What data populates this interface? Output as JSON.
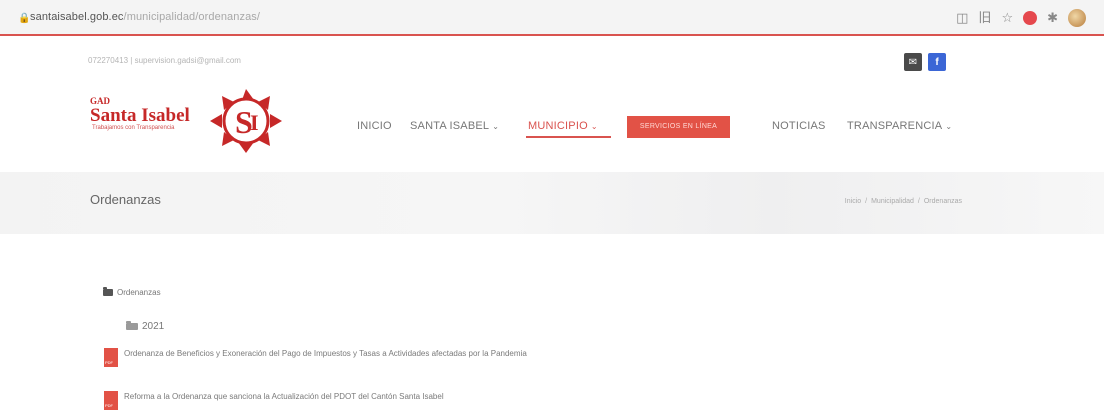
{
  "browser": {
    "url_host": "santaisabel.gob.ec",
    "url_path": "/municipalidad/ordenanzas/"
  },
  "topbar": {
    "contact": "072270413 | supervision.gadsi@gmail.com"
  },
  "logo": {
    "gad": "GAD",
    "name": "Santa Isabel",
    "tagline": "Trabajamos con Transparencia"
  },
  "nav": {
    "inicio": "INICIO",
    "santa_isabel": "SANTA ISABEL",
    "municipio": "MUNICIPIO",
    "servicios": "SERVICIOS EN LÍNEA",
    "noticias": "NOTICIAS",
    "transparencia": "TRANSPARENCIA",
    "caret": "⌄"
  },
  "page": {
    "title": "Ordenanzas",
    "breadcrumb": [
      "Inicio",
      "Municipalidad",
      "Ordenanzas"
    ],
    "crumb_sep": "/"
  },
  "tree": {
    "root_folder": "Ordenanzas",
    "year_folder": "2021",
    "documents": [
      "Ordenanza de Beneficios y Exoneración del Pago de Impuestos y Tasas a Actividades afectadas por la Pandemia",
      "Reforma a la Ordenanza que sanciona la Actualización del PDOT del Cantón Santa Isabel"
    ]
  },
  "colors": {
    "accent": "#d9534f",
    "facebook": "#3b66d6"
  }
}
